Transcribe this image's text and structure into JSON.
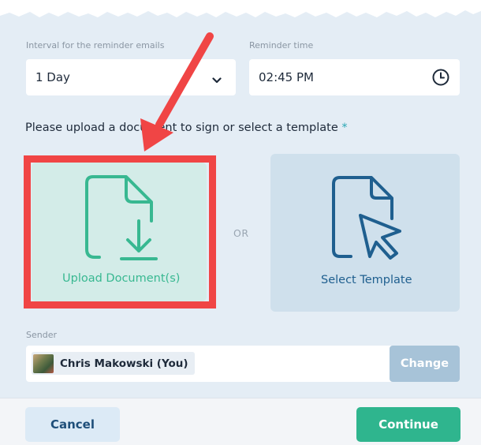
{
  "reminder": {
    "interval_label": "Interval for the reminder emails",
    "interval_value": "1 Day",
    "time_label": "Reminder time",
    "time_value": "02:45 PM"
  },
  "upload_prompt": {
    "text": "Please upload a document to sign or select a template",
    "required_marker": "*"
  },
  "options": {
    "upload_label": "Upload Document(s)",
    "or_label": "OR",
    "template_label": "Select Template"
  },
  "sender": {
    "label": "Sender",
    "name": "Chris Makowski (You)",
    "change_label": "Change"
  },
  "footer": {
    "cancel_label": "Cancel",
    "continue_label": "Continue"
  },
  "colors": {
    "accent_green": "#2fb58e",
    "accent_blue": "#1f5f8f",
    "annotation_red": "#f04545"
  },
  "icons": [
    "chevron-down-icon",
    "clock-icon",
    "document-download-icon",
    "document-cursor-icon",
    "red-arrow"
  ]
}
